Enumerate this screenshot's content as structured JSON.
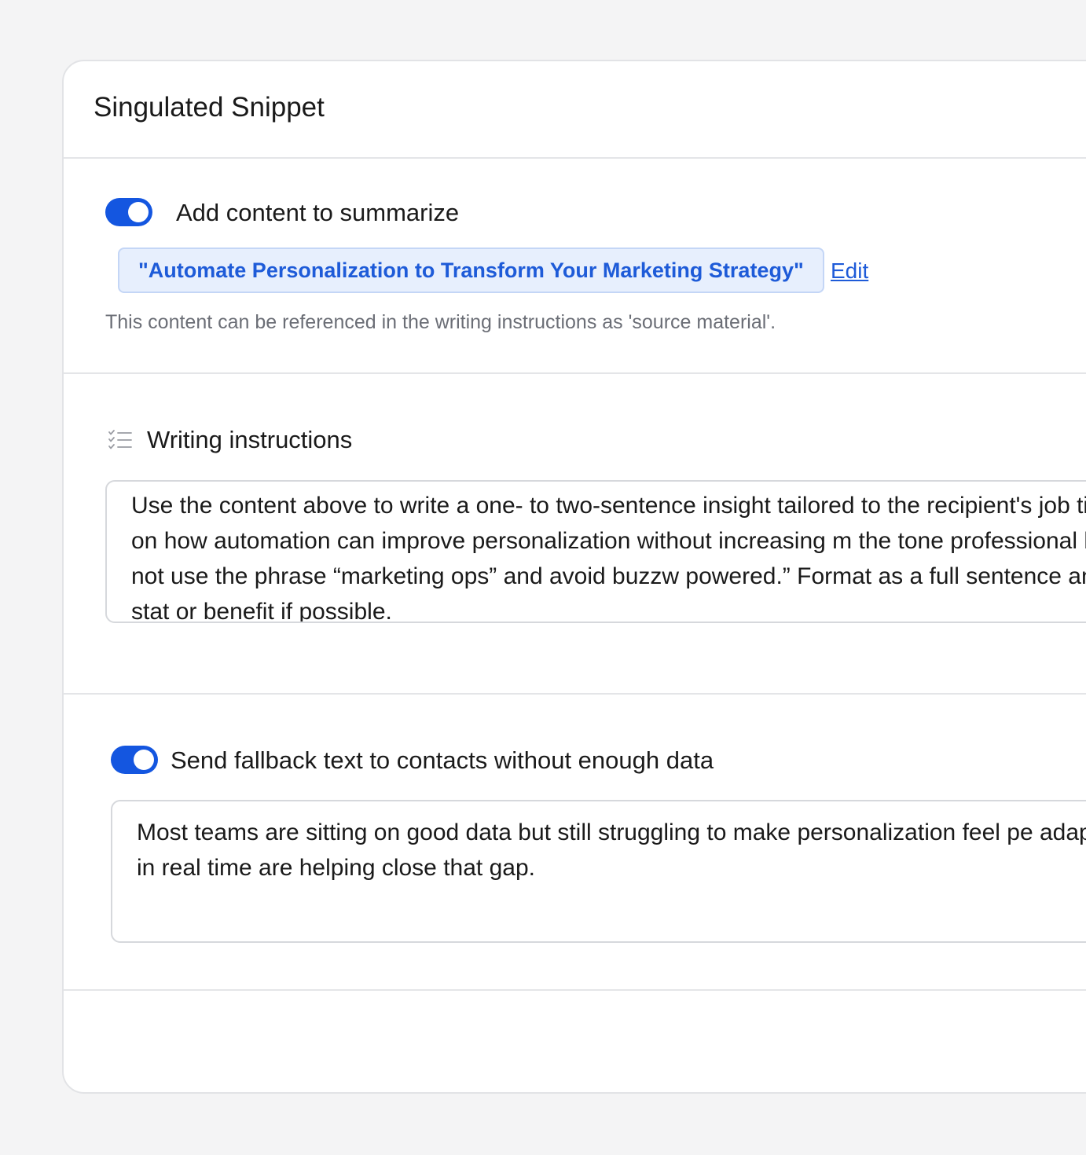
{
  "card": {
    "title": "Singulated Snippet"
  },
  "summarize": {
    "toggle_on": true,
    "label": "Add content to summarize",
    "content_chip": "\"Automate Personalization to Transform Your Marketing Strategy\"",
    "edit_label": "Edit",
    "helper_text": "This content can be referenced in the writing instructions as 'source material'."
  },
  "writing": {
    "icon": "checklist-icon",
    "label": "Writing instructions",
    "text": "Use the content above to write a one- to two-sentence insight tailored to the recipient's job title, focusing on how automation can improve personalization without increasing m the tone professional but warm. Do not use the phrase “marketing ops” and avoid buzzw powered.” Format as a full sentence and include a stat or benefit if possible."
  },
  "fallback": {
    "toggle_on": true,
    "label": "Send fallback text to contacts without enough data",
    "text": "Most teams are sitting on good data but still struggling to make personalization feel pe adapt messaging in real time are helping close that gap."
  },
  "colors": {
    "accent": "#1456e0",
    "chip_bg": "#e7effd",
    "chip_text": "#1e5bd8",
    "helper_text": "#6b6e76",
    "page_bg": "#f4f4f5"
  }
}
